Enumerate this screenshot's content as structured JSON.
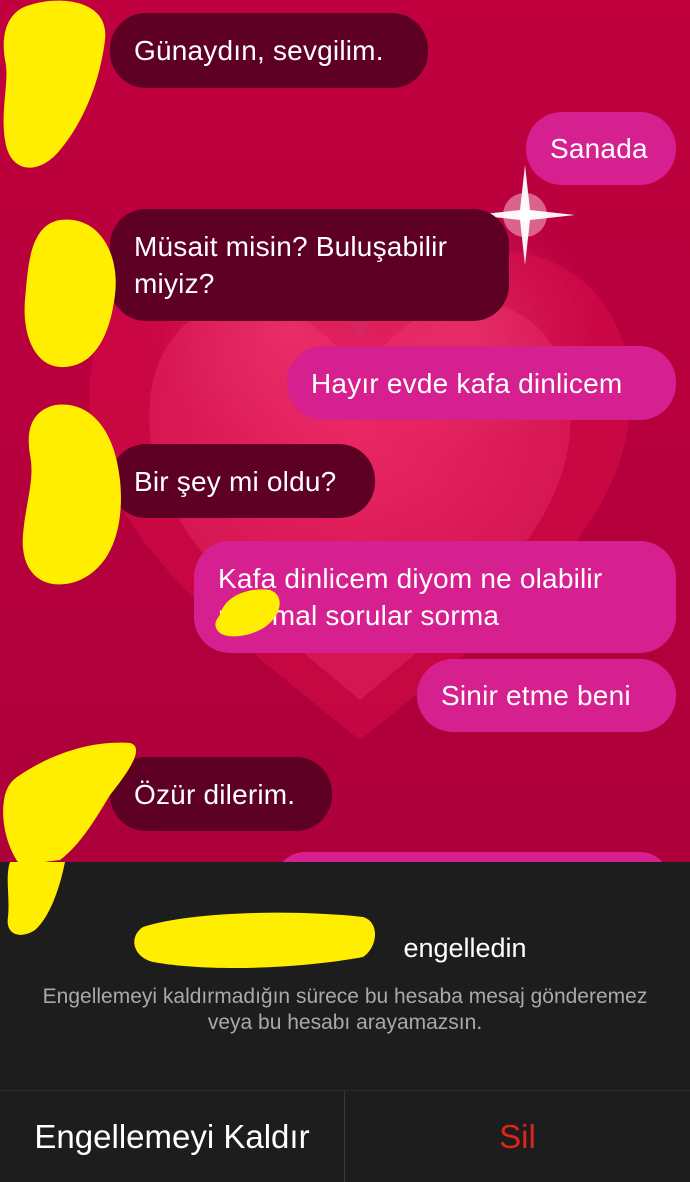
{
  "colors": {
    "background": "#b8003e",
    "incoming_bubble": "#5e0024",
    "outgoing_bubble": "#d6208f",
    "panel": "#1d1d1d",
    "delete_text": "#e0241b",
    "redaction": "#ffee00"
  },
  "messages": [
    {
      "direction": "incoming",
      "text": "Günaydın, sevgilim."
    },
    {
      "direction": "outgoing",
      "text": "Sanada"
    },
    {
      "direction": "incoming",
      "text": "Müsait misin? Buluşabilir\nmiyiz?"
    },
    {
      "direction": "outgoing",
      "text": "Hayır evde kafa dinlicem"
    },
    {
      "direction": "incoming",
      "text": "Bir şey mi oldu?"
    },
    {
      "direction": "outgoing",
      "text": "Kafa dinlicem diyom ne olabilir\n   mal mal sorular sorma"
    },
    {
      "direction": "outgoing",
      "text": "Sinir etme beni"
    },
    {
      "direction": "incoming",
      "text": "Özür dilerim."
    }
  ],
  "blocked_notice": {
    "suffix": "engelledin",
    "description": "Engellemeyi kaldırmadığın sürece bu hesaba mesaj gönderemez veya bu hesabı arayamazsın."
  },
  "actions": {
    "unblock_label": "Engellemeyi Kaldır",
    "delete_label": "Sil"
  }
}
